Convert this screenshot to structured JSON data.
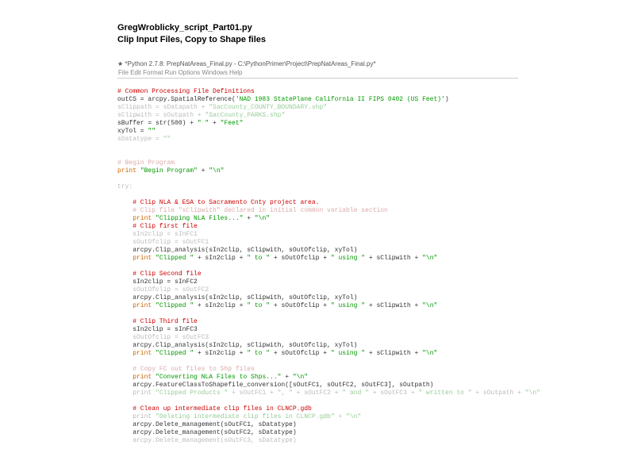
{
  "heading": {
    "filename": "GregWroblicky_script_Part01.py",
    "subtitle": "Clip Input Files, Copy to Shape files"
  },
  "window": {
    "glyph": "★",
    "title": "*Python 2.7.8: PrepNatAreas_Final.py - C:\\PythonPrimer\\Project\\PrepNatAreas_Final.py*",
    "menu": "File  Edit  Format  Run  Options  Windows  Help"
  },
  "code": {
    "c01": "# Common Processing File Definitions",
    "c02a": "outCS = arcpy.SpatialReference(",
    "c02b": "'NAD 1983 StatePlane California II FIPS 0402 (US Feet)'",
    "c02c": ")",
    "c03a": "sClippath = sDatapath + ",
    "c03b": "\"SacCounty_COUNTY_BOUNDARY.shp\"",
    "c04a": "sClipwith = sOutpath + ",
    "c04b": "\"SacCounty_PARKS.shp\"",
    "c05a": "sBuffer = str(500) + ",
    "c05b": "\" \"",
    "c05c": " + ",
    "c05d": "\"Feet\"",
    "c06a": "xyTol = ",
    "c06b": "\"\"",
    "c07a": "sDatatype = ",
    "c07b": "\"\"",
    "c08": "# Begin Program",
    "c09a": "print",
    "c09b": " \"Begin Program\"",
    "c09c": " + ",
    "c09d": "\"\\n\"",
    "c10": "try:",
    "c11": "    # Clip NLA & ESA to Sacramento Cnty project area.",
    "c12": "    # Clip file \"sClipwith\" declared in initial common variable section",
    "c13a": "    print",
    "c13b": " \"Clipping NLA Files...\"",
    "c13c": " + ",
    "c13d": "\"\\n\"",
    "c14": "    # Clip first file",
    "c15": "    sIn2clip = sInFC1",
    "c16": "    sOutOfclip = sOutFC1",
    "c17": "    arcpy.Clip_analysis(sIn2clip, sClipwith, sOutOfclip, xyTol)",
    "c18a": "    print",
    "c18b": " \"Clipped \"",
    "c18c": " + sIn2clip + ",
    "c18d": "\" to \"",
    "c18e": " + sOutOfclip + ",
    "c18f": "\" using \"",
    "c18g": " + sClipwith + ",
    "c18h": "\"\\n\"",
    "c19": "    # Clip Second file",
    "c20": "    sIn2clip = sInFC2",
    "c21": "    sOutOfclip = sOutFC2",
    "c22": "    arcpy.Clip_analysis(sIn2clip, sClipwith, sOutOfclip, xyTol)",
    "c23a": "    print",
    "c23b": " \"Clipped \"",
    "c23c": " + sIn2clip + ",
    "c23d": "\" to \"",
    "c23e": " + sOutOfclip + ",
    "c23f": "\" using \"",
    "c23g": " + sClipwith + ",
    "c23h": "\"\\n\"",
    "c24": "    # Clip Third file",
    "c25": "    sIn2clip = sInFC3",
    "c26": "    sOutOfclip = sOutFC3",
    "c27": "    arcpy.Clip_analysis(sIn2clip, sClipwith, sOutOfclip, xyTol)",
    "c28a": "    print",
    "c28b": " \"Clipped \"",
    "c28c": " + sIn2clip + ",
    "c28d": "\" to \"",
    "c28e": " + sOutOfclip + ",
    "c28f": "\" using \"",
    "c28g": " + sClipwith + ",
    "c28h": "\"\\n\"",
    "c29": "    # Copy FC out files to Shp files",
    "c30a": "    print",
    "c30b": " \"Converting NLA Files to Shps...\"",
    "c30c": " + ",
    "c30d": "\"\\n\"",
    "c31": "    arcpy.FeatureClassToShapefile_conversion([sOutFC1, sOutFC2, sOutFC3], sOutpath)",
    "c32a": "    print",
    "c32b": " \"Clipped Products \"",
    "c32c": " + sOutFC1 + ",
    "c32d": "\", \"",
    "c32e": " + sOutFC2 + ",
    "c32f": "\" and \"",
    "c32g": " + sOutFC3 + ",
    "c32h": "\" written to \"",
    "c32i": " + sOutpath + ",
    "c32j": "\"\\n\"",
    "c33": "    # Clean up intermediate clip files in CLNCP.gdb",
    "c34a": "    print",
    "c34b": " \"Deleting intermediate clip files in CLNCP.gdb\"",
    "c34c": " + ",
    "c34d": "\"\\n\"",
    "c35": "    arcpy.Delete_management(sOutFC1, sDatatype)",
    "c36": "    arcpy.Delete_management(sOutFC2, sDatatype)",
    "c37": "    arcpy.Delete_management(sOutFC3, sDatatype)"
  }
}
